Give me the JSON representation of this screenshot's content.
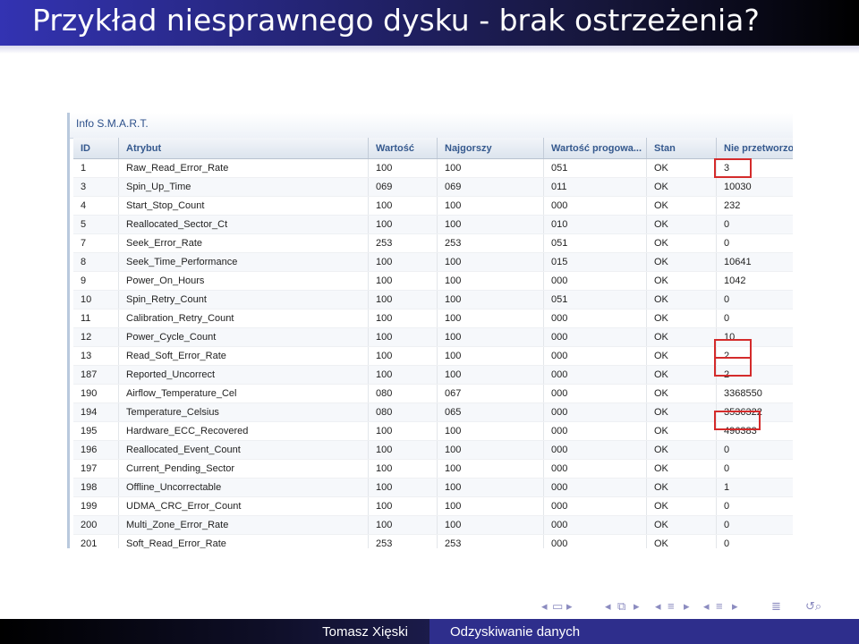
{
  "slide": {
    "title": "Przykład niesprawnego dysku - brak ostrzeżenia?"
  },
  "smart_panel": {
    "title": "Info S.M.A.R.T.",
    "columns": [
      "ID",
      "Atrybut",
      "Wartość",
      "Najgorszy",
      "Wartość progowa...",
      "Stan",
      "Nie przetworzo"
    ],
    "rows": [
      {
        "id": "1",
        "attr": "Raw_Read_Error_Rate",
        "value": "100",
        "worst": "100",
        "threshold": "051",
        "state": "OK",
        "raw": "3",
        "flagged": true
      },
      {
        "id": "3",
        "attr": "Spin_Up_Time",
        "value": "069",
        "worst": "069",
        "threshold": "011",
        "state": "OK",
        "raw": "10030",
        "flagged": false
      },
      {
        "id": "4",
        "attr": "Start_Stop_Count",
        "value": "100",
        "worst": "100",
        "threshold": "000",
        "state": "OK",
        "raw": "232",
        "flagged": false
      },
      {
        "id": "5",
        "attr": "Reallocated_Sector_Ct",
        "value": "100",
        "worst": "100",
        "threshold": "010",
        "state": "OK",
        "raw": "0",
        "flagged": false
      },
      {
        "id": "7",
        "attr": "Seek_Error_Rate",
        "value": "253",
        "worst": "253",
        "threshold": "051",
        "state": "OK",
        "raw": "0",
        "flagged": false
      },
      {
        "id": "8",
        "attr": "Seek_Time_Performance",
        "value": "100",
        "worst": "100",
        "threshold": "015",
        "state": "OK",
        "raw": "10641",
        "flagged": false
      },
      {
        "id": "9",
        "attr": "Power_On_Hours",
        "value": "100",
        "worst": "100",
        "threshold": "000",
        "state": "OK",
        "raw": "1042",
        "flagged": false
      },
      {
        "id": "10",
        "attr": "Spin_Retry_Count",
        "value": "100",
        "worst": "100",
        "threshold": "051",
        "state": "OK",
        "raw": "0",
        "flagged": false
      },
      {
        "id": "11",
        "attr": "Calibration_Retry_Count",
        "value": "100",
        "worst": "100",
        "threshold": "000",
        "state": "OK",
        "raw": "0",
        "flagged": false
      },
      {
        "id": "12",
        "attr": "Power_Cycle_Count",
        "value": "100",
        "worst": "100",
        "threshold": "000",
        "state": "OK",
        "raw": "10",
        "flagged": false
      },
      {
        "id": "13",
        "attr": "Read_Soft_Error_Rate",
        "value": "100",
        "worst": "100",
        "threshold": "000",
        "state": "OK",
        "raw": "2",
        "flagged": true
      },
      {
        "id": "187",
        "attr": "Reported_Uncorrect",
        "value": "100",
        "worst": "100",
        "threshold": "000",
        "state": "OK",
        "raw": "2",
        "flagged": true
      },
      {
        "id": "190",
        "attr": "Airflow_Temperature_Cel",
        "value": "080",
        "worst": "067",
        "threshold": "000",
        "state": "OK",
        "raw": "3368550",
        "flagged": false
      },
      {
        "id": "194",
        "attr": "Temperature_Celsius",
        "value": "080",
        "worst": "065",
        "threshold": "000",
        "state": "OK",
        "raw": "3536322",
        "flagged": false
      },
      {
        "id": "195",
        "attr": "Hardware_ECC_Recovered",
        "value": "100",
        "worst": "100",
        "threshold": "000",
        "state": "OK",
        "raw": "496383",
        "flagged": true
      },
      {
        "id": "196",
        "attr": "Reallocated_Event_Count",
        "value": "100",
        "worst": "100",
        "threshold": "000",
        "state": "OK",
        "raw": "0",
        "flagged": false
      },
      {
        "id": "197",
        "attr": "Current_Pending_Sector",
        "value": "100",
        "worst": "100",
        "threshold": "000",
        "state": "OK",
        "raw": "0",
        "flagged": false
      },
      {
        "id": "198",
        "attr": "Offline_Uncorrectable",
        "value": "100",
        "worst": "100",
        "threshold": "000",
        "state": "OK",
        "raw": "1",
        "flagged": false
      },
      {
        "id": "199",
        "attr": "UDMA_CRC_Error_Count",
        "value": "100",
        "worst": "100",
        "threshold": "000",
        "state": "OK",
        "raw": "0",
        "flagged": false
      },
      {
        "id": "200",
        "attr": "Multi_Zone_Error_Rate",
        "value": "100",
        "worst": "100",
        "threshold": "000",
        "state": "OK",
        "raw": "0",
        "flagged": false
      },
      {
        "id": "201",
        "attr": "Soft_Read_Error_Rate",
        "value": "253",
        "worst": "253",
        "threshold": "000",
        "state": "OK",
        "raw": "0",
        "flagged": false
      }
    ]
  },
  "colors": {
    "highlight": "#d42b2b",
    "header_text": "#35598e",
    "footer_right": "#2e2e8c"
  },
  "navigation": {
    "icons": [
      "nav-frame-left-icon",
      "nav-frame-icon",
      "nav-frame-right-icon",
      "nav-subsection-left-icon",
      "nav-subsection-icon",
      "nav-subsection-right-icon",
      "nav-section-left-icon",
      "nav-section-icon",
      "nav-section-right-icon",
      "nav-align-icon",
      "search-icon"
    ]
  },
  "footer": {
    "author": "Tomasz Xięski",
    "talk": "Odzyskiwanie danych"
  }
}
